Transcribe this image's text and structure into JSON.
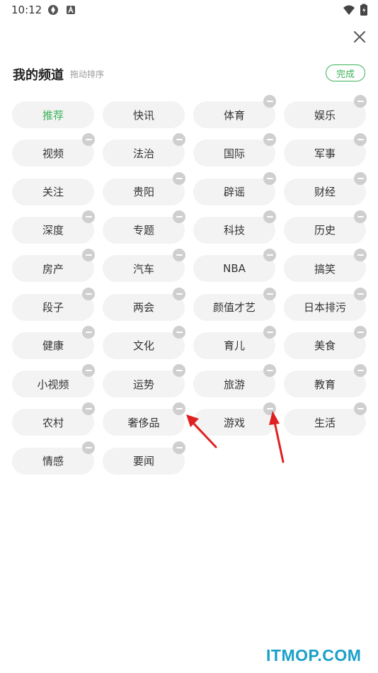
{
  "status": {
    "time": "10:12",
    "icons": [
      "sync-icon",
      "a-badge-icon",
      "wifi-icon",
      "battery-icon"
    ]
  },
  "header": {
    "title": "我的频道",
    "subtitle": "拖动排序",
    "done_label": "完成"
  },
  "colors": {
    "accent": "#3cb25a",
    "chip_bg": "#f3f3f3",
    "remove_badge": "#cfcfcf",
    "arrow": "#e02020",
    "watermark": "#19a0c8"
  },
  "channels": [
    {
      "label": "推荐",
      "active": true,
      "removable": false
    },
    {
      "label": "快讯",
      "active": false,
      "removable": false
    },
    {
      "label": "体育",
      "active": false,
      "removable": true
    },
    {
      "label": "娱乐",
      "active": false,
      "removable": true
    },
    {
      "label": "视频",
      "active": false,
      "removable": true
    },
    {
      "label": "法治",
      "active": false,
      "removable": true
    },
    {
      "label": "国际",
      "active": false,
      "removable": true
    },
    {
      "label": "军事",
      "active": false,
      "removable": true
    },
    {
      "label": "关注",
      "active": false,
      "removable": false
    },
    {
      "label": "贵阳",
      "active": false,
      "removable": true
    },
    {
      "label": "辟谣",
      "active": false,
      "removable": true
    },
    {
      "label": "财经",
      "active": false,
      "removable": true
    },
    {
      "label": "深度",
      "active": false,
      "removable": true
    },
    {
      "label": "专题",
      "active": false,
      "removable": true
    },
    {
      "label": "科技",
      "active": false,
      "removable": true
    },
    {
      "label": "历史",
      "active": false,
      "removable": true
    },
    {
      "label": "房产",
      "active": false,
      "removable": true
    },
    {
      "label": "汽车",
      "active": false,
      "removable": true
    },
    {
      "label": "NBA",
      "active": false,
      "removable": true
    },
    {
      "label": "搞笑",
      "active": false,
      "removable": true
    },
    {
      "label": "段子",
      "active": false,
      "removable": true
    },
    {
      "label": "两会",
      "active": false,
      "removable": true
    },
    {
      "label": "颜值才艺",
      "active": false,
      "removable": true
    },
    {
      "label": "日本排污",
      "active": false,
      "removable": true
    },
    {
      "label": "健康",
      "active": false,
      "removable": true
    },
    {
      "label": "文化",
      "active": false,
      "removable": true
    },
    {
      "label": "育儿",
      "active": false,
      "removable": true
    },
    {
      "label": "美食",
      "active": false,
      "removable": true
    },
    {
      "label": "小视频",
      "active": false,
      "removable": true
    },
    {
      "label": "运势",
      "active": false,
      "removable": true
    },
    {
      "label": "旅游",
      "active": false,
      "removable": true
    },
    {
      "label": "教育",
      "active": false,
      "removable": true
    },
    {
      "label": "农村",
      "active": false,
      "removable": true
    },
    {
      "label": "奢侈品",
      "active": false,
      "removable": true
    },
    {
      "label": "游戏",
      "active": false,
      "removable": true
    },
    {
      "label": "生活",
      "active": false,
      "removable": true
    },
    {
      "label": "情感",
      "active": false,
      "removable": true
    },
    {
      "label": "要闻",
      "active": false,
      "removable": true
    }
  ],
  "watermark": "ITMOP.COM"
}
